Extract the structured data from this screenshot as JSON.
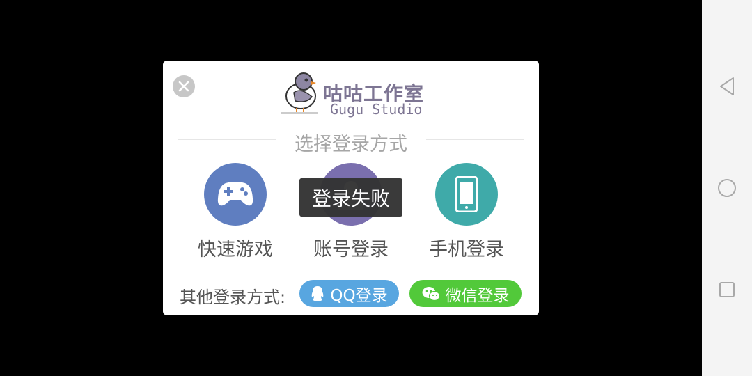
{
  "dialog": {
    "logo": {
      "name_cn": "咕咕工作室",
      "name_en": "Gugu Studio"
    },
    "title": "选择登录方式",
    "options": [
      {
        "label": "快速游戏",
        "icon": "gamepad-icon"
      },
      {
        "label": "账号登录",
        "icon": "user-icon"
      },
      {
        "label": "手机登录",
        "icon": "phone-icon"
      }
    ],
    "toast": "登录失败",
    "other_login_label": "其他登录方式:",
    "qq_label": "QQ登录",
    "wechat_label": "微信登录"
  },
  "colors": {
    "quick": "#5f7ec0",
    "account": "#7a6fae",
    "phone": "#3faaa9",
    "qq": "#58a6e0",
    "wechat": "#52c93a"
  }
}
